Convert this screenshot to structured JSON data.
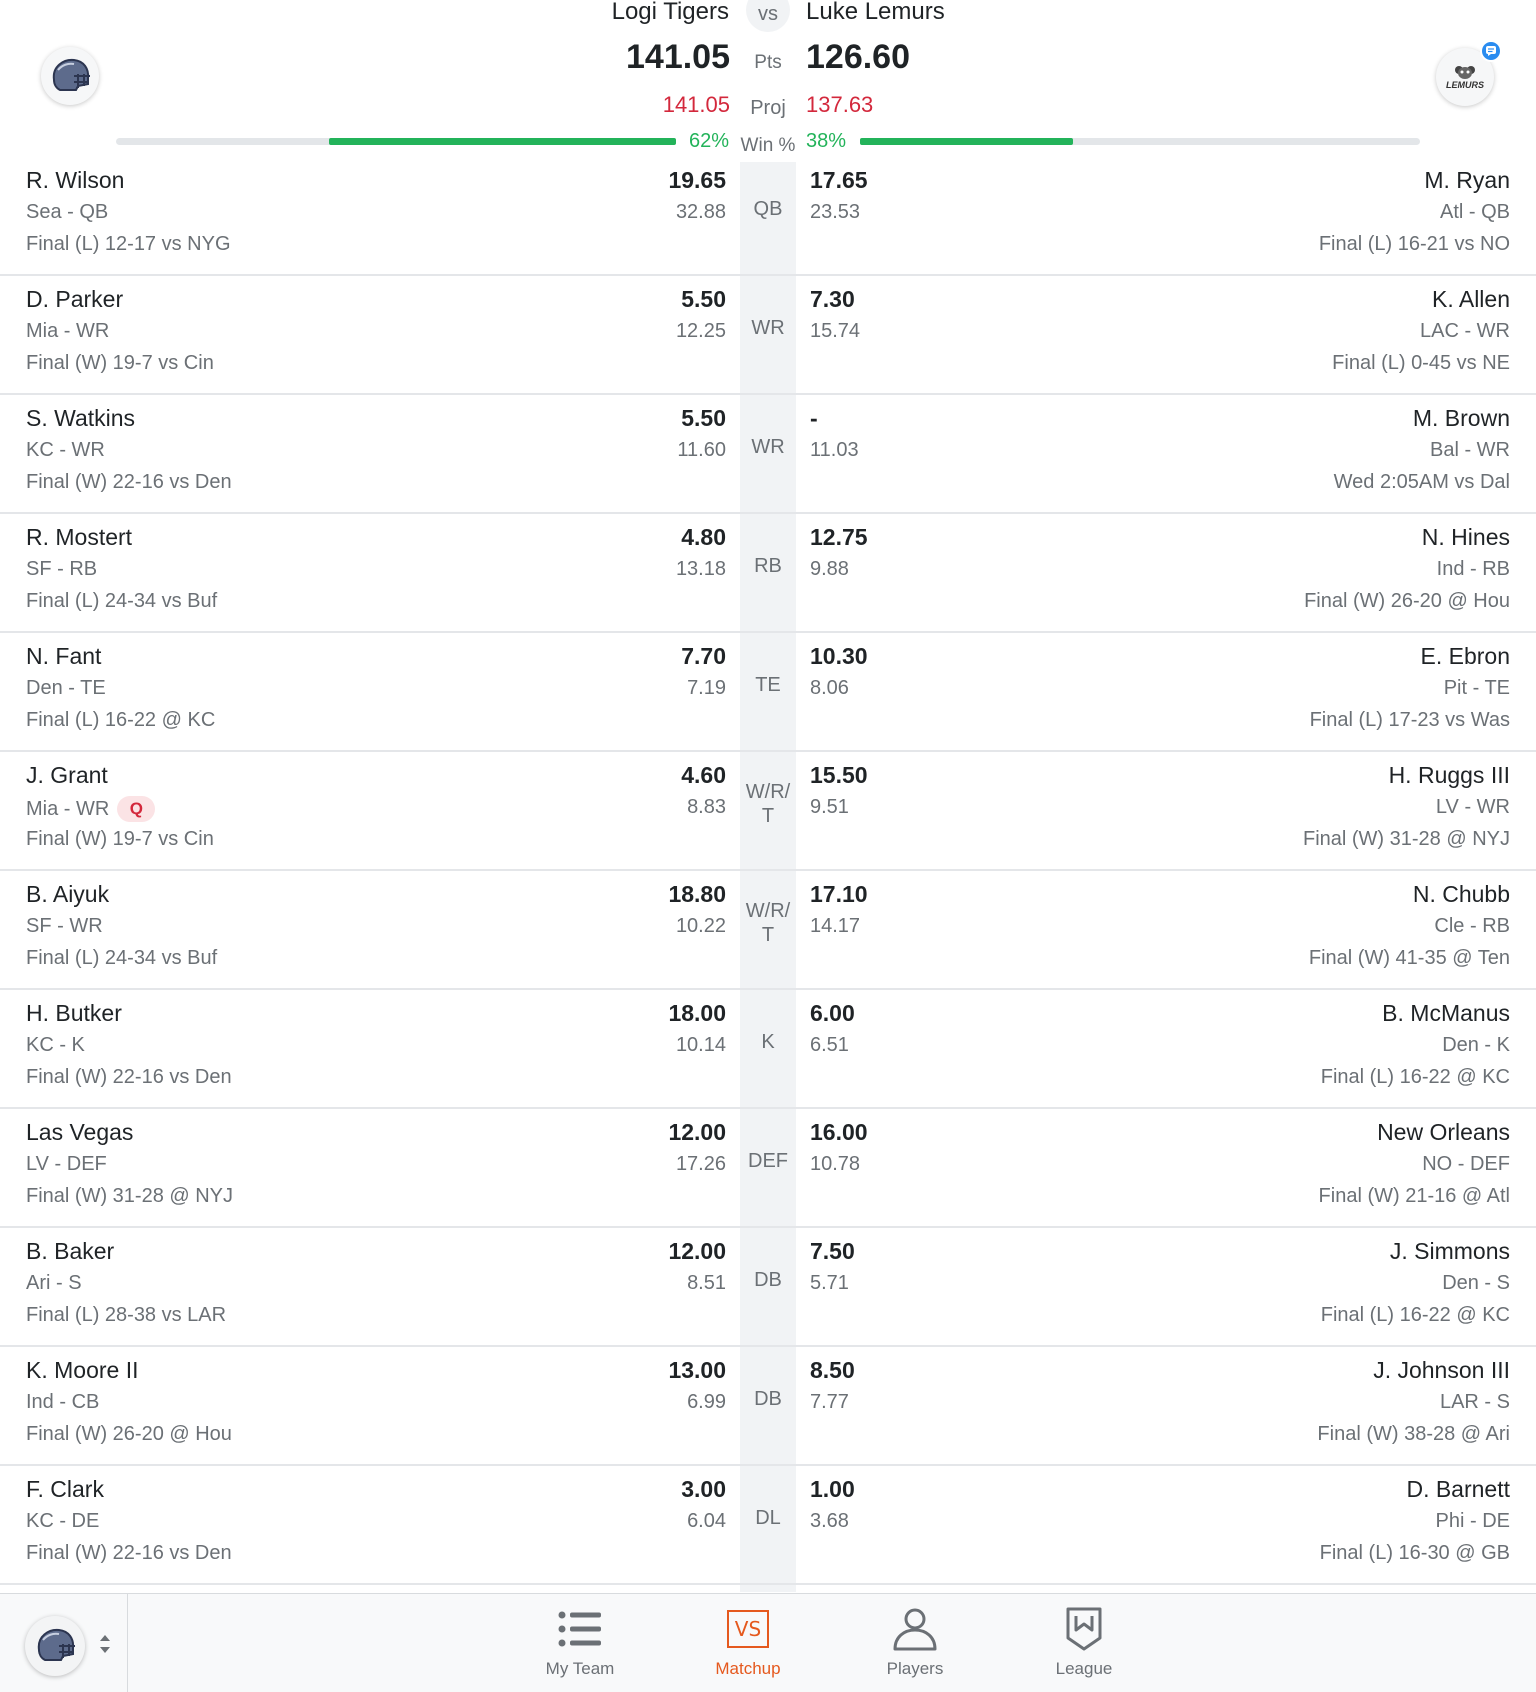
{
  "header": {
    "team1": {
      "name": "Logi Tigers",
      "pts": "141.05",
      "proj": "141.05",
      "win_pct": "62%",
      "win_fraction": 0.62
    },
    "team2": {
      "name": "Luke Lemurs",
      "pts": "126.60",
      "proj": "137.63",
      "win_pct": "38%",
      "win_fraction": 0.38
    },
    "vs_label": "vs",
    "pts_label": "Pts",
    "proj_label": "Proj",
    "win_label": "Win %",
    "team2_avatar_text": "LEMURS"
  },
  "rows": [
    {
      "slot": "QB",
      "left": {
        "name": "R. Wilson",
        "pos": "Sea - QB",
        "game": "Final (L) 12-17 vs NYG",
        "score": "19.65",
        "proj": "32.88"
      },
      "right": {
        "name": "M. Ryan",
        "pos": "Atl - QB",
        "game": "Final (L) 16-21 vs NO",
        "score": "17.65",
        "proj": "23.53"
      }
    },
    {
      "slot": "WR",
      "left": {
        "name": "D. Parker",
        "pos": "Mia - WR",
        "game": "Final (W) 19-7 vs Cin",
        "score": "5.50",
        "proj": "12.25"
      },
      "right": {
        "name": "K. Allen",
        "pos": "LAC - WR",
        "game": "Final (L) 0-45 vs NE",
        "score": "7.30",
        "proj": "15.74"
      }
    },
    {
      "slot": "WR",
      "left": {
        "name": "S. Watkins",
        "pos": "KC - WR",
        "game": "Final (W) 22-16 vs Den",
        "score": "5.50",
        "proj": "11.60"
      },
      "right": {
        "name": "M. Brown",
        "pos": "Bal - WR",
        "game": "Wed 2:05AM  vs Dal",
        "score": "-",
        "proj": "11.03"
      }
    },
    {
      "slot": "RB",
      "left": {
        "name": "R. Mostert",
        "pos": "SF - RB",
        "game": "Final (L) 24-34 vs Buf",
        "score": "4.80",
        "proj": "13.18"
      },
      "right": {
        "name": "N. Hines",
        "pos": "Ind - RB",
        "game": "Final (W) 26-20 @ Hou",
        "score": "12.75",
        "proj": "9.88"
      }
    },
    {
      "slot": "TE",
      "left": {
        "name": "N. Fant",
        "pos": "Den - TE",
        "game": "Final (L) 16-22 @ KC",
        "score": "7.70",
        "proj": "7.19"
      },
      "right": {
        "name": "E. Ebron",
        "pos": "Pit - TE",
        "game": "Final (L) 17-23 vs Was",
        "score": "10.30",
        "proj": "8.06"
      }
    },
    {
      "slot": "W/R/T",
      "left": {
        "name": "J. Grant",
        "pos": "Mia - WR",
        "badge": "Q",
        "game": "Final (W) 19-7 vs Cin",
        "score": "4.60",
        "proj": "8.83"
      },
      "right": {
        "name": "H. Ruggs III",
        "pos": "LV - WR",
        "game": "Final (W) 31-28 @ NYJ",
        "score": "15.50",
        "proj": "9.51"
      }
    },
    {
      "slot": "W/R/T",
      "left": {
        "name": "B. Aiyuk",
        "pos": "SF - WR",
        "game": "Final (L) 24-34 vs Buf",
        "score": "18.80",
        "proj": "10.22"
      },
      "right": {
        "name": "N. Chubb",
        "pos": "Cle - RB",
        "game": "Final (W) 41-35 @ Ten",
        "score": "17.10",
        "proj": "14.17"
      }
    },
    {
      "slot": "K",
      "left": {
        "name": "H. Butker",
        "pos": "KC - K",
        "game": "Final (W) 22-16 vs Den",
        "score": "18.00",
        "proj": "10.14"
      },
      "right": {
        "name": "B. McManus",
        "pos": "Den - K",
        "game": "Final (L) 16-22 @ KC",
        "score": "6.00",
        "proj": "6.51"
      }
    },
    {
      "slot": "DEF",
      "left": {
        "name": "Las Vegas",
        "pos": "LV - DEF",
        "game": "Final (W) 31-28 @ NYJ",
        "score": "12.00",
        "proj": "17.26"
      },
      "right": {
        "name": "New Orleans",
        "pos": "NO - DEF",
        "game": "Final (W) 21-16 @ Atl",
        "score": "16.00",
        "proj": "10.78"
      }
    },
    {
      "slot": "DB",
      "left": {
        "name": "B. Baker",
        "pos": "Ari - S",
        "game": "Final (L) 28-38 vs LAR",
        "score": "12.00",
        "proj": "8.51"
      },
      "right": {
        "name": "J. Simmons",
        "pos": "Den - S",
        "game": "Final (L) 16-22 @ KC",
        "score": "7.50",
        "proj": "5.71"
      }
    },
    {
      "slot": "DB",
      "left": {
        "name": "K. Moore II",
        "pos": "Ind - CB",
        "game": "Final (W) 26-20 @ Hou",
        "score": "13.00",
        "proj": "6.99"
      },
      "right": {
        "name": "J. Johnson III",
        "pos": "LAR - S",
        "game": "Final (W) 38-28 @ Ari",
        "score": "8.50",
        "proj": "7.77"
      }
    },
    {
      "slot": "DL",
      "left": {
        "name": "F. Clark",
        "pos": "KC - DE",
        "game": "Final (W) 22-16 vs Den",
        "score": "3.00",
        "proj": "6.04"
      },
      "right": {
        "name": "D. Barnett",
        "pos": "Phi - DE",
        "game": "Final (L) 16-30 @ GB",
        "score": "1.00",
        "proj": "3.68"
      }
    }
  ],
  "nav": {
    "items": [
      {
        "id": "my-team",
        "label": "My Team",
        "icon": "list-icon"
      },
      {
        "id": "matchup",
        "label": "Matchup",
        "icon": "vs-icon",
        "active": true,
        "icon_text": "VS"
      },
      {
        "id": "players",
        "label": "Players",
        "icon": "person-icon"
      },
      {
        "id": "league",
        "label": "League",
        "icon": "shield-icon"
      }
    ]
  },
  "colors": {
    "accent": "#e5591e",
    "win_bar": "#23b35a",
    "projection": "#d3283c",
    "badge_blue": "#2a8cf0"
  }
}
